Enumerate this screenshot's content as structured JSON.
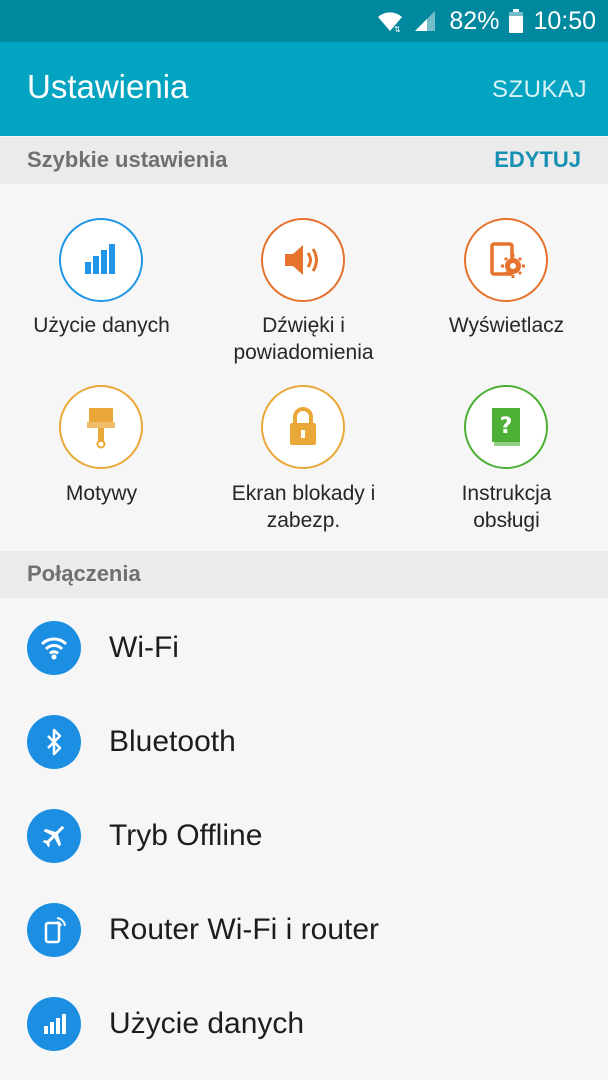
{
  "status_bar": {
    "battery_percent": "82%",
    "time": "10:50",
    "icons": [
      "wifi-icon",
      "cell-signal-icon",
      "battery-icon"
    ]
  },
  "app_bar": {
    "title": "Ustawienia",
    "search_label": "SZUKAJ"
  },
  "quick_settings": {
    "header": "Szybkie ustawienia",
    "edit_label": "EDYTUJ",
    "items": [
      {
        "label_line1": "Użycie danych",
        "label_line2": "",
        "icon": "data-usage-icon",
        "color": "#2196e6"
      },
      {
        "label_line1": "Dźwięki i",
        "label_line2": "powiadomienia",
        "icon": "speaker-icon",
        "color": "#e5732e"
      },
      {
        "label_line1": "Wyświetlacz",
        "label_line2": "",
        "icon": "display-settings-icon",
        "color": "#e5732e"
      },
      {
        "label_line1": "Motywy",
        "label_line2": "",
        "icon": "paintbrush-icon",
        "color": "#e9a838"
      },
      {
        "label_line1": "Ekran blokady i",
        "label_line2": "zabezp.",
        "icon": "lock-icon",
        "color": "#e9a838"
      },
      {
        "label_line1": "Instrukcja",
        "label_line2": "obsługi",
        "icon": "help-book-icon",
        "color": "#4caf36"
      }
    ]
  },
  "connections": {
    "header": "Połączenia",
    "items": [
      {
        "label": "Wi-Fi",
        "icon": "wifi-icon"
      },
      {
        "label": "Bluetooth",
        "icon": "bluetooth-icon"
      },
      {
        "label": "Tryb Offline",
        "icon": "airplane-icon"
      },
      {
        "label": "Router Wi-Fi i router",
        "icon": "hotspot-icon"
      },
      {
        "label": "Użycie danych",
        "icon": "data-usage-icon"
      }
    ]
  },
  "colors": {
    "status_bar": "#00889f",
    "app_bar": "#03a4c1",
    "accent": "#1590b3",
    "list_icon": "#1c8fe3"
  }
}
